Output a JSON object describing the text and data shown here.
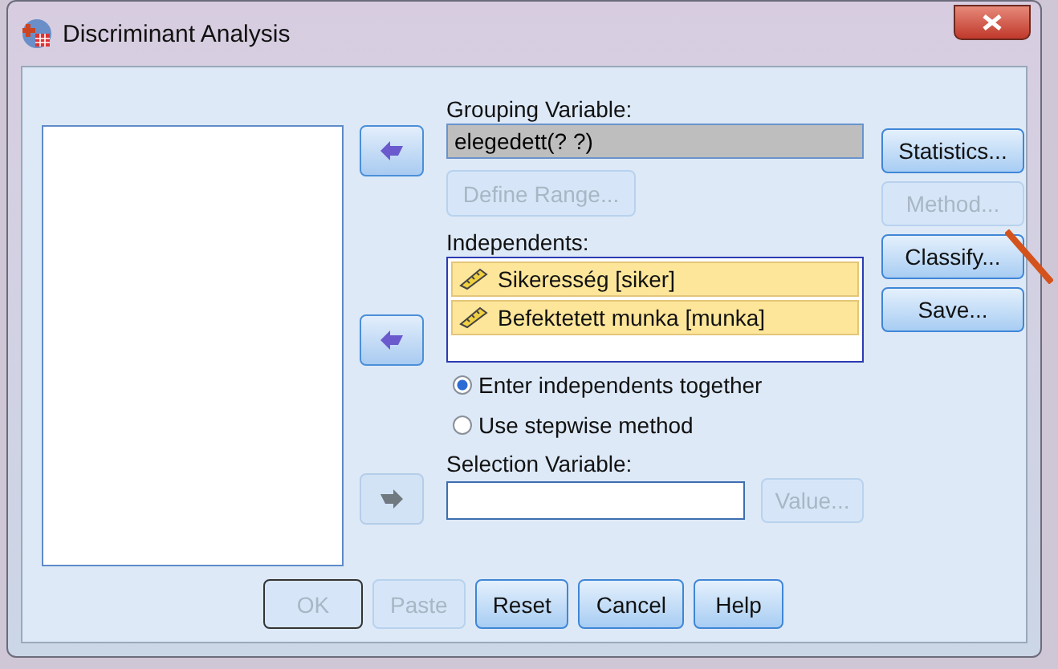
{
  "window": {
    "title": "Discriminant Analysis"
  },
  "grouping": {
    "label": "Grouping Variable:",
    "value": "elegedett(? ?)",
    "define_range": {
      "label": "Define Range...",
      "disabled": true
    }
  },
  "independents": {
    "label": "Independents:",
    "items": [
      {
        "label": "Sikeresség [siker]",
        "selected": true
      },
      {
        "label": "Befektetett munka [munka]",
        "selected": true
      }
    ]
  },
  "method_options": [
    {
      "label": "Enter independents together",
      "selected": true
    },
    {
      "label": "Use stepwise method",
      "selected": false
    }
  ],
  "selection": {
    "label": "Selection Variable:",
    "value_button": {
      "label": "Value...",
      "disabled": true
    }
  },
  "arrows": [
    {
      "disabled": false
    },
    {
      "disabled": false
    },
    {
      "disabled": true
    }
  ],
  "side_buttons": [
    {
      "label": "Statistics...",
      "disabled": false
    },
    {
      "label": "Method...",
      "disabled": true
    },
    {
      "label": "Classify...",
      "disabled": false
    },
    {
      "label": "Save...",
      "disabled": false
    }
  ],
  "bottom_buttons": [
    {
      "label": "OK",
      "disabled": true
    },
    {
      "label": "Paste",
      "disabled": true
    },
    {
      "label": "Reset",
      "disabled": false
    },
    {
      "label": "Cancel",
      "disabled": false
    },
    {
      "label": "Help",
      "disabled": false
    }
  ]
}
